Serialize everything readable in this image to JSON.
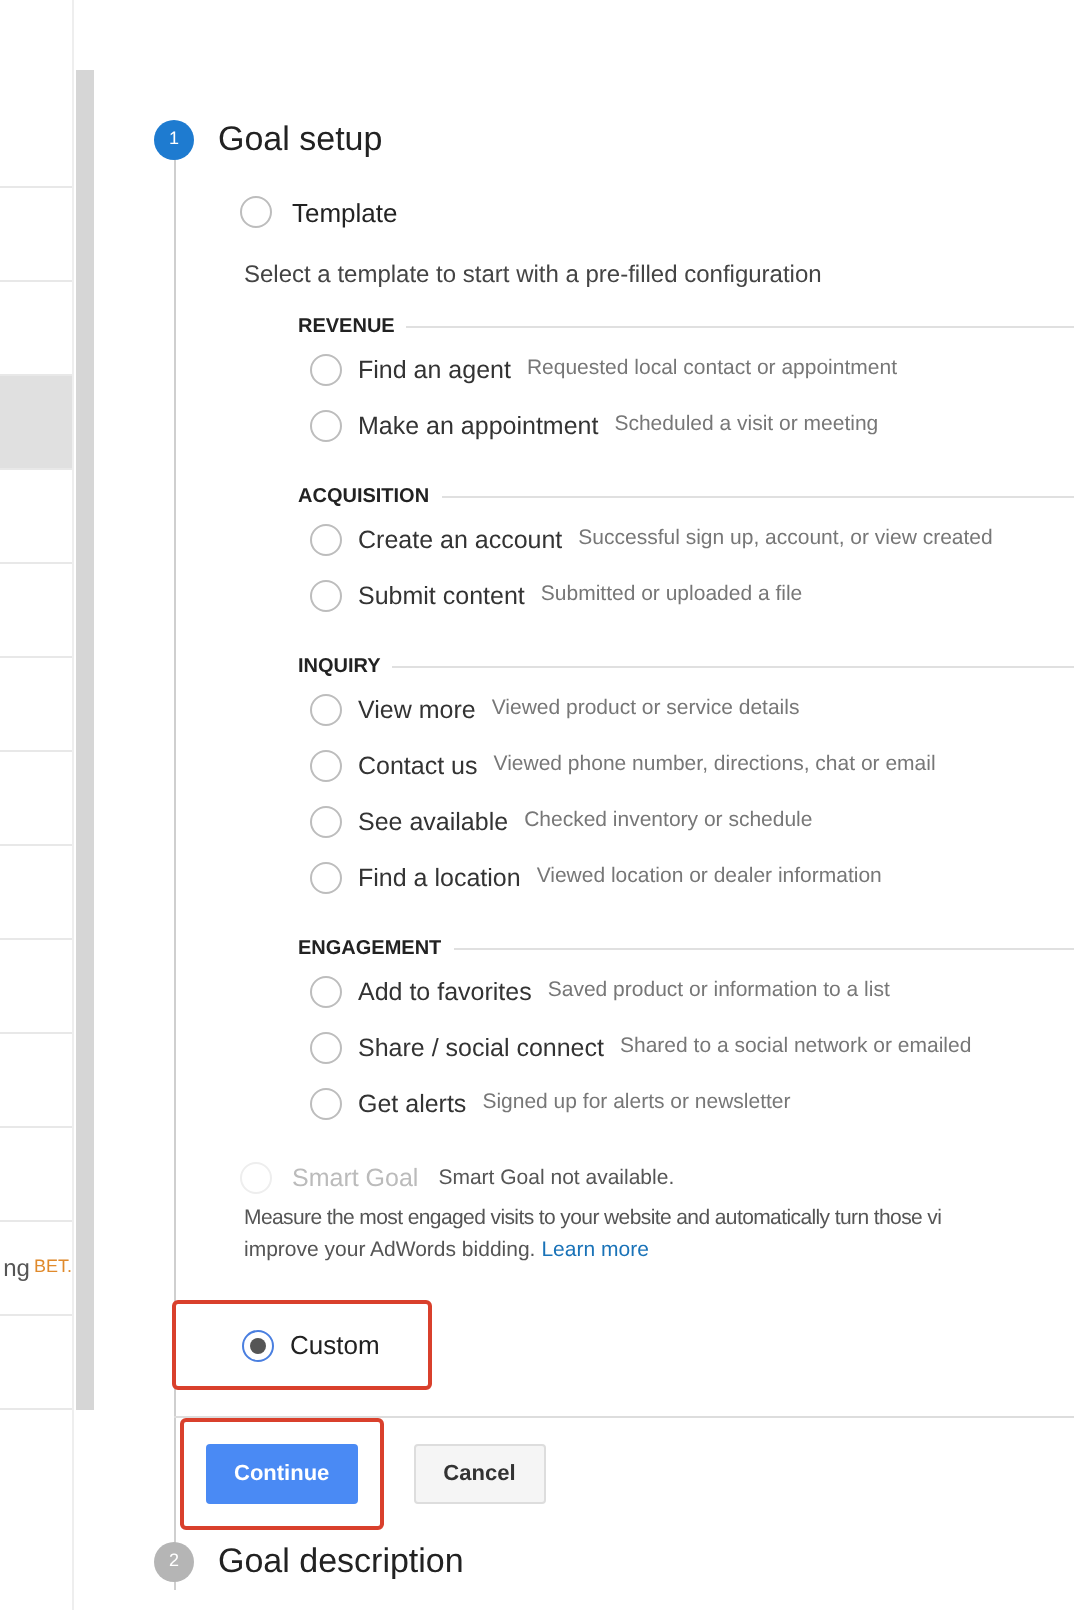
{
  "sidebar": {
    "items": [
      {
        "selected": false
      },
      {
        "selected": false
      },
      {
        "selected": true
      },
      {
        "selected": false
      },
      {
        "selected": false
      },
      {
        "selected": false
      },
      {
        "selected": false
      },
      {
        "selected": false
      },
      {
        "selected": false
      },
      {
        "selected": false
      },
      {
        "selected": false
      },
      {
        "selected": false,
        "label": "ng",
        "badge": "BET."
      },
      {
        "selected": false
      },
      {
        "selected": false
      }
    ]
  },
  "steps": [
    {
      "number": "1",
      "title": "Goal setup",
      "active": true
    },
    {
      "number": "2",
      "title": "Goal description",
      "active": false
    }
  ],
  "template": {
    "label": "Template",
    "selected": false,
    "description": "Select a template to start with a pre-filled configuration",
    "groups": [
      {
        "title": "REVENUE",
        "options": [
          {
            "label": "Find an agent",
            "hint": "Requested local contact or appointment",
            "selected": false
          },
          {
            "label": "Make an appointment",
            "hint": "Scheduled a visit or meeting",
            "selected": false
          }
        ]
      },
      {
        "title": "ACQUISITION",
        "options": [
          {
            "label": "Create an account",
            "hint": "Successful sign up, account, or view created",
            "selected": false
          },
          {
            "label": "Submit content",
            "hint": "Submitted or uploaded a file",
            "selected": false
          }
        ]
      },
      {
        "title": "INQUIRY",
        "options": [
          {
            "label": "View more",
            "hint": "Viewed product or service details",
            "selected": false
          },
          {
            "label": "Contact us",
            "hint": "Viewed phone number, directions, chat or email",
            "selected": false
          },
          {
            "label": "See available",
            "hint": "Checked inventory or schedule",
            "selected": false
          },
          {
            "label": "Find a location",
            "hint": "Viewed location or dealer information",
            "selected": false
          }
        ]
      },
      {
        "title": "ENGAGEMENT",
        "options": [
          {
            "label": "Add to favorites",
            "hint": "Saved product or information to a list",
            "selected": false
          },
          {
            "label": "Share / social connect",
            "hint": "Shared to a social network or emailed",
            "selected": false
          },
          {
            "label": "Get alerts",
            "hint": "Signed up for alerts or newsletter",
            "selected": false
          }
        ]
      }
    ]
  },
  "smart_goal": {
    "label": "Smart Goal",
    "note": "Smart Goal not available.",
    "disabled": true,
    "selected": false,
    "description": "Measure the most engaged visits to your website and automatically turn those vi",
    "description_2": "improve your AdWords bidding.",
    "link": "Learn more"
  },
  "custom": {
    "label": "Custom",
    "selected": true,
    "highlighted": true
  },
  "buttons": [
    {
      "label": "Continue",
      "kind": "primary",
      "highlighted": true
    },
    {
      "label": "Cancel",
      "kind": "secondary",
      "highlighted": false
    }
  ]
}
